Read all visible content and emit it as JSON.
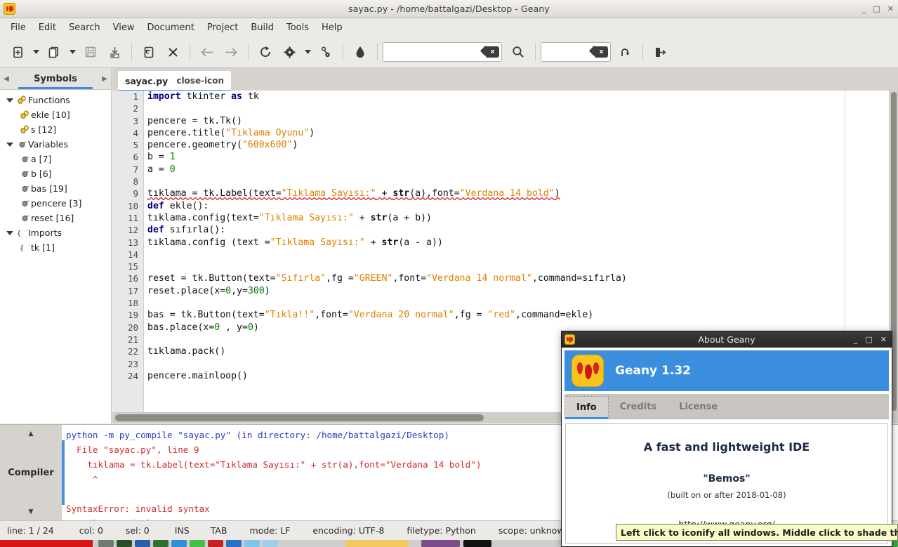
{
  "window": {
    "title": "sayac.py - /home/battalgazi/Desktop - Geany",
    "app_icon": "geany-logo-icon",
    "controls": {
      "minimize": "_",
      "maximize": "□",
      "close": "✕"
    }
  },
  "menubar": {
    "items": [
      "File",
      "Edit",
      "Search",
      "View",
      "Document",
      "Project",
      "Build",
      "Tools",
      "Help"
    ]
  },
  "toolbar": {
    "buttons": [
      {
        "name": "new-document-icon",
        "tip": "New"
      },
      {
        "name": "new-document-dropdown-icon",
        "tip": "New from template"
      },
      {
        "name": "open-document-icon",
        "tip": "Open"
      },
      {
        "name": "open-recent-dropdown-icon",
        "tip": "Open recent"
      },
      {
        "name": "save-icon",
        "tip": "Save"
      },
      {
        "name": "save-all-icon",
        "tip": "Save All"
      },
      {
        "name": "revert-icon",
        "tip": "Revert"
      },
      {
        "name": "close-icon",
        "tip": "Close"
      },
      {
        "name": "navigate-back-icon",
        "tip": "Back"
      },
      {
        "name": "navigate-forward-icon",
        "tip": "Forward"
      },
      {
        "name": "compile-icon",
        "tip": "Compile"
      },
      {
        "name": "build-icon",
        "tip": "Build"
      },
      {
        "name": "build-dropdown-icon",
        "tip": "Build options"
      },
      {
        "name": "run-icon",
        "tip": "Run"
      },
      {
        "name": "color-chooser-icon",
        "tip": "Color Chooser"
      }
    ],
    "search_field": {
      "value": "",
      "placeholder": "",
      "clear_icon": "clear-icon"
    },
    "goto_field": {
      "value": "",
      "placeholder": "",
      "clear_icon": "clear-icon"
    },
    "find_icon": "search-icon",
    "jump_icon": "jump-to-line-icon",
    "quit_icon": "quit-icon"
  },
  "sidebar": {
    "tab_label": "Symbols",
    "prev_icon": "chevron-left-icon",
    "next_icon": "chevron-right-icon",
    "tree": [
      {
        "label": "Functions",
        "icon": "function-icon",
        "level": 0,
        "expanded": true
      },
      {
        "label": "ekle [10]",
        "icon": "function-icon",
        "level": 1
      },
      {
        "label": "s [12]",
        "icon": "function-icon",
        "level": 1
      },
      {
        "label": "Variables",
        "icon": "variable-icon",
        "level": 0,
        "expanded": true
      },
      {
        "label": "a [7]",
        "icon": "variable-icon",
        "level": 1
      },
      {
        "label": "b [6]",
        "icon": "variable-icon",
        "level": 1
      },
      {
        "label": "bas [19]",
        "icon": "variable-icon",
        "level": 1
      },
      {
        "label": "pencere [3]",
        "icon": "variable-icon",
        "level": 1
      },
      {
        "label": "reset [16]",
        "icon": "variable-icon",
        "level": 1
      },
      {
        "label": "Imports",
        "icon": "namespace-icon",
        "level": 0,
        "expanded": true
      },
      {
        "label": "tk [1]",
        "icon": "namespace-icon",
        "level": 1
      }
    ]
  },
  "editor": {
    "tab": {
      "label": "sayac.py",
      "close_icon": "close-icon"
    },
    "total_lines": 24,
    "lines": [
      {
        "n": 1,
        "html": "<span class='kw'>import</span> tkinter <span class='kw'>as</span> tk"
      },
      {
        "n": 2,
        "html": ""
      },
      {
        "n": 3,
        "html": "pencere = tk.Tk()"
      },
      {
        "n": 4,
        "html": "pencere.title(<span class='str'>\"Tıklama Oyunu\"</span>)"
      },
      {
        "n": 5,
        "html": "pencere.geometry(<span class='str'>\"600x600\"</span>)"
      },
      {
        "n": 6,
        "html": "b = <span class='num'>1</span>"
      },
      {
        "n": 7,
        "html": "a = <span class='num'>0</span>"
      },
      {
        "n": 8,
        "html": ""
      },
      {
        "n": 9,
        "html": "<span class='err'>tıklama = tk.Label(text=<span class='str'>\"Tıklama Sayısı:\"</span> + <span class='bin'>str</span>(a),font=<span class='str'>\"Verdana 14 bold\"</span>)</span>"
      },
      {
        "n": 10,
        "html": "<span class='kw'>def</span> ekle():"
      },
      {
        "n": 11,
        "html": "tıklama.config(text=<span class='str'>\"Tıklama Sayısı:\"</span> + <span class='bin'>str</span>(a + b))"
      },
      {
        "n": 12,
        "html": "<span class='kw'>def</span> sıfırla():"
      },
      {
        "n": 13,
        "html": "tıklama.config (text =<span class='str'>\"Tıklama Sayısı:\"</span> + <span class='bin'>str</span>(a - a))"
      },
      {
        "n": 14,
        "html": ""
      },
      {
        "n": 15,
        "html": ""
      },
      {
        "n": 16,
        "html": "reset = tk.Button(text=<span class='str'>\"Sıfırla\"</span>,fg =<span class='str'>\"GREEN\"</span>,font=<span class='str'>\"Verdana 14 normal\"</span>,command=sıfırla)"
      },
      {
        "n": 17,
        "html": "reset.place(x=<span class='num'>0</span>,y=<span class='num'>300</span>)"
      },
      {
        "n": 18,
        "html": ""
      },
      {
        "n": 19,
        "html": "bas = tk.Button(text=<span class='str'>\"Tıkla!!\"</span>,font=<span class='str'>\"Verdana 20 normal\"</span>,fg = <span class='str'>\"red\"</span>,command=ekle)"
      },
      {
        "n": 20,
        "html": "bas.place(x=<span class='num'>0</span> , y=<span class='num'>0</span>)"
      },
      {
        "n": 21,
        "html": ""
      },
      {
        "n": 22,
        "html": "tıklama.pack()"
      },
      {
        "n": 23,
        "html": ""
      },
      {
        "n": 24,
        "html": "pencere.mainloop()"
      }
    ]
  },
  "message_panel": {
    "label": "Compiler",
    "scroll_up_icon": "chevron-up-icon",
    "scroll_down_icon": "chevron-down-icon",
    "lines": [
      {
        "text": "python -m py_compile \"sayac.py\" (in directory: /home/battalgazi/Desktop)",
        "color": "blue"
      },
      {
        "text": "  File \"sayac.py\", line 9",
        "color": "red"
      },
      {
        "text": "    tıklama = tk.Label(text=\"Tıklama Sayısı:\" + str(a),font=\"Verdana 14 bold\")",
        "color": "red"
      },
      {
        "text": "     ^",
        "color": "red"
      },
      {
        "text": "",
        "color": "blue"
      },
      {
        "text": "SyntaxError: invalid syntax",
        "color": "red"
      },
      {
        "text": "Compilation failed.",
        "color": "blue"
      }
    ]
  },
  "statusbar": {
    "line": "line: 1 / 24",
    "col": "col: 0",
    "sel": "sel: 0",
    "insert_mode": "INS",
    "tab_mode": "TAB",
    "eol_mode": "mode: LF",
    "encoding": "encoding: UTF-8",
    "filetype": "filetype: Python",
    "scope": "scope: unknown"
  },
  "about_dialog": {
    "title": "About Geany",
    "icon": "geany-logo-icon",
    "controls": {
      "minimize": "_",
      "maximize": "□",
      "close": "✕"
    },
    "version": "Geany 1.32",
    "tabs": [
      {
        "label": "Info",
        "active": true
      },
      {
        "label": "Credits",
        "active": false
      },
      {
        "label": "License",
        "active": false
      }
    ],
    "tagline": "A fast and lightweight IDE",
    "codename": "\"Bemos\"",
    "build_date": "(built on or after 2018-01-08)",
    "url": "http://www.geany.org/"
  },
  "tooltip": {
    "text": "Left click to iconify all windows.  Middle click to shade them."
  },
  "colors": {
    "accent_blue": "#3a8ee6",
    "banner_blue": "#3b8ede",
    "keyword": "#00007f",
    "string": "#e08000",
    "number": "#008000",
    "error_red": "#d42a2a",
    "info_blue": "#2a38c8",
    "tooltip_bg": "#fbfbc8"
  }
}
